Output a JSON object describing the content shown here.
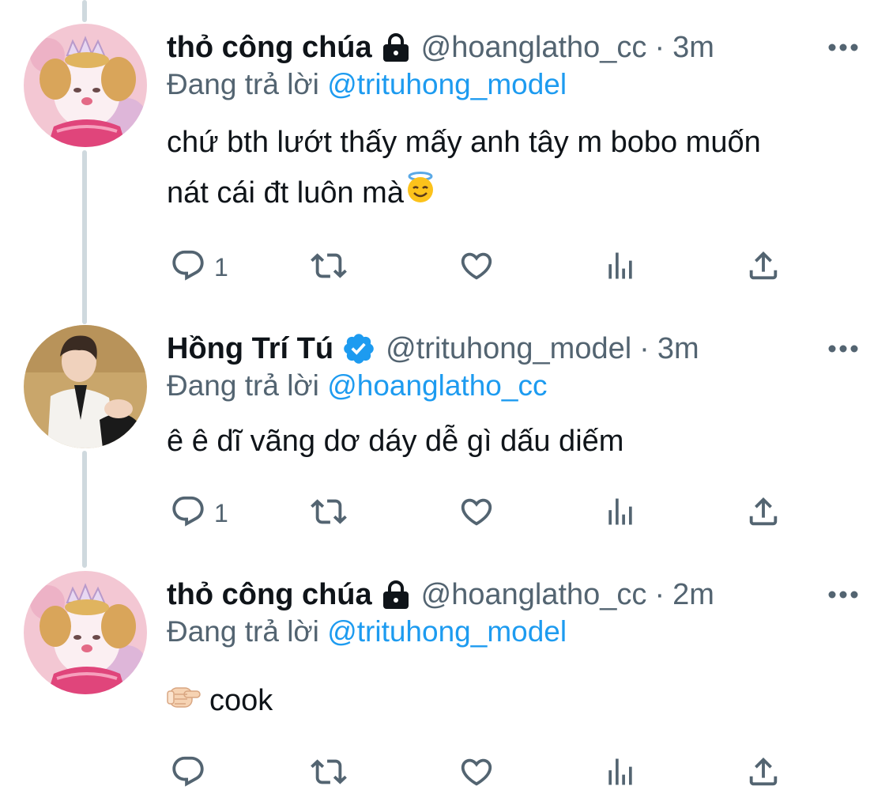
{
  "tweets": [
    {
      "display_name": "thỏ công chúa",
      "badge": "lock-icon",
      "handle": "@hoanglatho_cc",
      "separator": "·",
      "time": "3m",
      "reply_prefix": "Đang trả lời",
      "reply_mention": "@trituhong_model",
      "text_line1": "chứ bth lướt thấy mấy anh tây m bobo muốn",
      "text_line2": "nát cái đt luôn mà",
      "emoji": "smiling-face-with-halo",
      "reply_count": "1"
    },
    {
      "display_name": "Hồng Trí Tú",
      "badge": "verified-icon",
      "handle": "@trituhong_model",
      "separator": "·",
      "time": "3m",
      "reply_prefix": "Đang trả lời",
      "reply_mention": "@hoanglatho_cc",
      "text_line1": "ê ê dĩ vãng dơ dáy dễ gì dấu diếm",
      "reply_count": "1"
    },
    {
      "display_name": "thỏ công chúa",
      "badge": "lock-icon",
      "handle": "@hoanglatho_cc",
      "separator": "·",
      "time": "2m",
      "reply_prefix": "Đang trả lời",
      "reply_mention": "@trituhong_model",
      "emoji": "backhand-index-pointing-right",
      "text_line1": "cook",
      "reply_count": ""
    }
  ],
  "colors": {
    "text": "#0f1419",
    "secondary": "#536471",
    "link": "#1d9bf0",
    "thread_line": "#cfd9de",
    "verified": "#1d9bf0"
  },
  "icons": [
    "reply-icon",
    "retweet-icon",
    "like-icon",
    "views-icon",
    "share-icon",
    "more-icon"
  ]
}
